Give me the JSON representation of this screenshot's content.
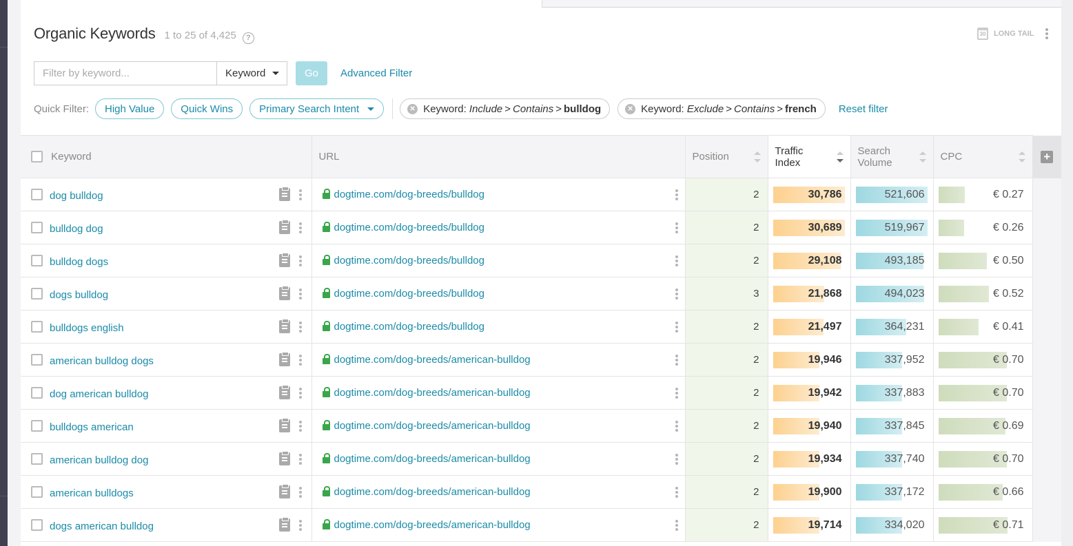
{
  "header": {
    "title": "Organic Keywords",
    "count": "1 to 25 of 4,425",
    "help_icon": "question-circle-icon",
    "longtail_label": "LONG TAIL",
    "calendar_day": "30"
  },
  "filter": {
    "placeholder": "Filter by keyword...",
    "value": "",
    "field_select": "Keyword",
    "go_label": "Go",
    "advanced_label": "Advanced Filter"
  },
  "quick_filter": {
    "label": "Quick Filter:",
    "pills": [
      "High Value",
      "Quick Wins",
      "Primary Search Intent"
    ],
    "chips": [
      {
        "field": "Keyword:",
        "mode": "Include",
        "op": "Contains",
        "value": "bulldog"
      },
      {
        "field": "Keyword:",
        "mode": "Exclude",
        "op": "Contains",
        "value": "french"
      }
    ],
    "reset_label": "Reset filter"
  },
  "table": {
    "columns": {
      "keyword": "Keyword",
      "url": "URL",
      "position": "Position",
      "traffic_index_1": "Traffic",
      "traffic_index_2": "Index",
      "search_volume_1": "Search",
      "search_volume_2": "Volume",
      "cpc": "CPC"
    },
    "sort": {
      "column": "traffic_index",
      "direction": "desc"
    },
    "colors": {
      "traffic": "#fdd18f",
      "volume": "#9ed8e1",
      "cpc": "#cfdcbc",
      "position_bg": "#f0f6ea",
      "link": "#1a8ba8"
    },
    "rows": [
      {
        "keyword": "dog bulldog",
        "url": "dogtime.com/dog-breeds/bulldog",
        "position": "2",
        "traffic": "30,786",
        "volume": "521,606",
        "cpc": "€ 0.27",
        "traffic_n": 30786,
        "volume_n": 521606,
        "cpc_n": 0.27
      },
      {
        "keyword": "bulldog dog",
        "url": "dogtime.com/dog-breeds/bulldog",
        "position": "2",
        "traffic": "30,689",
        "volume": "519,967",
        "cpc": "€ 0.26",
        "traffic_n": 30689,
        "volume_n": 519967,
        "cpc_n": 0.26
      },
      {
        "keyword": "bulldog dogs",
        "url": "dogtime.com/dog-breeds/bulldog",
        "position": "2",
        "traffic": "29,108",
        "volume": "493,185",
        "cpc": "€ 0.50",
        "traffic_n": 29108,
        "volume_n": 493185,
        "cpc_n": 0.5
      },
      {
        "keyword": "dogs bulldog",
        "url": "dogtime.com/dog-breeds/bulldog",
        "position": "3",
        "traffic": "21,868",
        "volume": "494,023",
        "cpc": "€ 0.52",
        "traffic_n": 21868,
        "volume_n": 494023,
        "cpc_n": 0.52
      },
      {
        "keyword": "bulldogs english",
        "url": "dogtime.com/dog-breeds/bulldog",
        "position": "2",
        "traffic": "21,497",
        "volume": "364,231",
        "cpc": "€ 0.41",
        "traffic_n": 21497,
        "volume_n": 364231,
        "cpc_n": 0.41
      },
      {
        "keyword": "american bulldog dogs",
        "url": "dogtime.com/dog-breeds/american-bulldog",
        "position": "2",
        "traffic": "19,946",
        "volume": "337,952",
        "cpc": "€ 0.70",
        "traffic_n": 19946,
        "volume_n": 337952,
        "cpc_n": 0.7
      },
      {
        "keyword": "dog american bulldog",
        "url": "dogtime.com/dog-breeds/american-bulldog",
        "position": "2",
        "traffic": "19,942",
        "volume": "337,883",
        "cpc": "€ 0.70",
        "traffic_n": 19942,
        "volume_n": 337883,
        "cpc_n": 0.7
      },
      {
        "keyword": "bulldogs american",
        "url": "dogtime.com/dog-breeds/american-bulldog",
        "position": "2",
        "traffic": "19,940",
        "volume": "337,845",
        "cpc": "€ 0.69",
        "traffic_n": 19940,
        "volume_n": 337845,
        "cpc_n": 0.69
      },
      {
        "keyword": "american bulldog dog",
        "url": "dogtime.com/dog-breeds/american-bulldog",
        "position": "2",
        "traffic": "19,934",
        "volume": "337,740",
        "cpc": "€ 0.70",
        "traffic_n": 19934,
        "volume_n": 337740,
        "cpc_n": 0.7
      },
      {
        "keyword": "american bulldogs",
        "url": "dogtime.com/dog-breeds/american-bulldog",
        "position": "2",
        "traffic": "19,900",
        "volume": "337,172",
        "cpc": "€ 0.66",
        "traffic_n": 19900,
        "volume_n": 337172,
        "cpc_n": 0.66
      },
      {
        "keyword": "dogs american bulldog",
        "url": "dogtime.com/dog-breeds/american-bulldog",
        "position": "2",
        "traffic": "19,714",
        "volume": "334,020",
        "cpc": "€ 0.71",
        "traffic_n": 19714,
        "volume_n": 334020,
        "cpc_n": 0.71
      }
    ],
    "bar_scale": {
      "traffic_max": 30786,
      "volume_max": 521606,
      "cpc_max": 0.71
    }
  }
}
